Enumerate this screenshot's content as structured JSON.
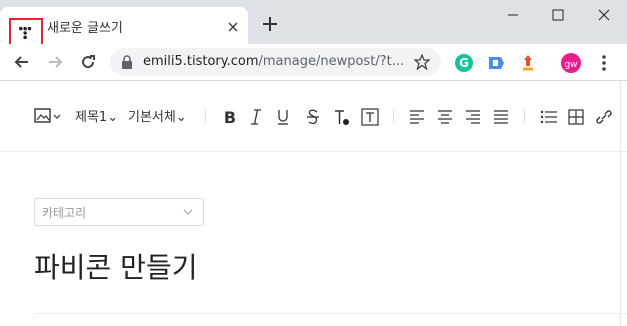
{
  "browser": {
    "tab": {
      "title": "새로운 글쓰기",
      "favicon": "tistory-icon"
    },
    "window_controls": [
      "minimize-icon",
      "maximize-icon",
      "close-icon"
    ]
  },
  "toolbar": {
    "url_host": "emili5.tistory.com",
    "url_rest": "/manage/newpost/?t...",
    "extensions": [
      {
        "name": "grammarly-icon",
        "color": "#15c39a"
      },
      {
        "name": "tag-extension-icon",
        "color": "#4a90e2"
      },
      {
        "name": "pin-extension-icon",
        "color": "#e0532b"
      },
      {
        "name": "profile-avatar",
        "label": "gw",
        "color": "#e91e8c"
      }
    ]
  },
  "editor": {
    "heading_dropdown": "제목1",
    "font_dropdown": "기본서체",
    "category_placeholder": "카테고리",
    "post_title": "파비콘 만들기"
  },
  "colors": {
    "highlight_box": "#e0262b",
    "tabstrip": "#dee1e6"
  }
}
